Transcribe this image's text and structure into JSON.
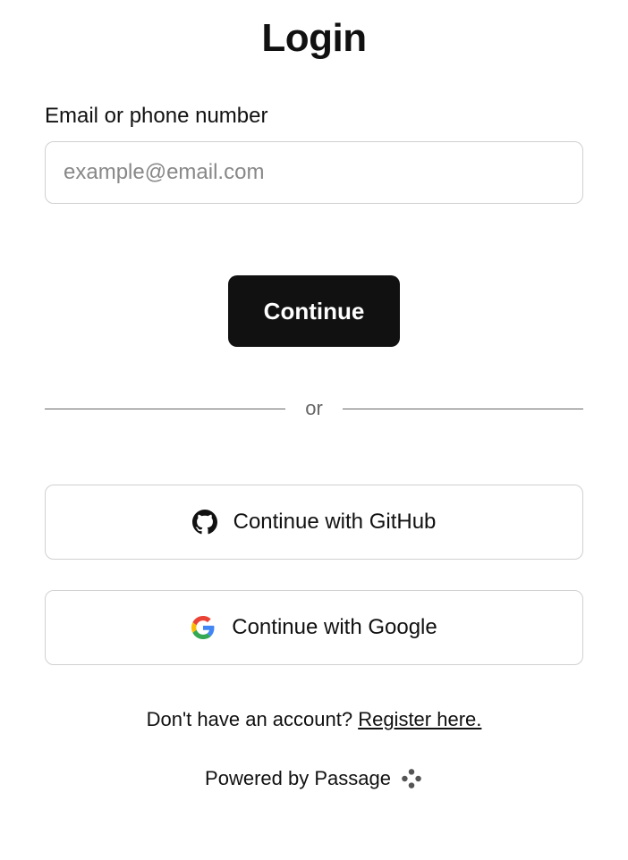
{
  "title": "Login",
  "identifier": {
    "label": "Email or phone number",
    "placeholder": "example@email.com",
    "value": ""
  },
  "primary_action": {
    "label": "Continue"
  },
  "divider_text": "or",
  "oauth": {
    "github": {
      "label": "Continue with GitHub"
    },
    "google": {
      "label": "Continue with Google"
    }
  },
  "register": {
    "prompt": "Don't have an account? ",
    "link_text": "Register here."
  },
  "powered_by": "Powered by Passage"
}
